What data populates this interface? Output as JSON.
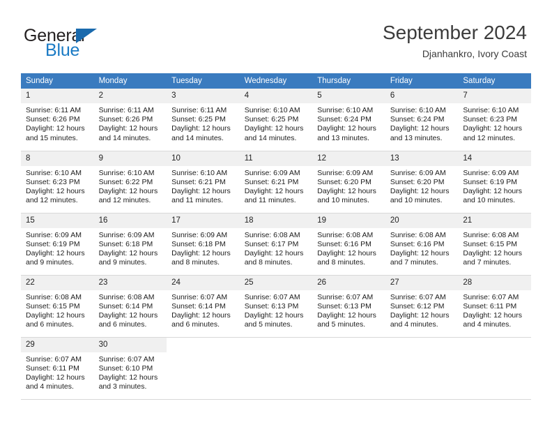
{
  "brand": {
    "name_top": "General",
    "name_bottom": "Blue",
    "triangle_icon": "triangle-icon",
    "color_dark": "#231f20",
    "color_blue": "#1a7ac4"
  },
  "header": {
    "month_title": "September 2024",
    "location": "Djanhankro, Ivory Coast"
  },
  "calendar": {
    "accent_color": "#3a7bbf",
    "daynum_bg": "#f0f0f0",
    "weekdays": [
      "Sunday",
      "Monday",
      "Tuesday",
      "Wednesday",
      "Thursday",
      "Friday",
      "Saturday"
    ],
    "weeks": [
      [
        {
          "day": "1",
          "sunrise": "Sunrise: 6:11 AM",
          "sunset": "Sunset: 6:26 PM",
          "daylight1": "Daylight: 12 hours",
          "daylight2": "and 15 minutes."
        },
        {
          "day": "2",
          "sunrise": "Sunrise: 6:11 AM",
          "sunset": "Sunset: 6:26 PM",
          "daylight1": "Daylight: 12 hours",
          "daylight2": "and 14 minutes."
        },
        {
          "day": "3",
          "sunrise": "Sunrise: 6:11 AM",
          "sunset": "Sunset: 6:25 PM",
          "daylight1": "Daylight: 12 hours",
          "daylight2": "and 14 minutes."
        },
        {
          "day": "4",
          "sunrise": "Sunrise: 6:10 AM",
          "sunset": "Sunset: 6:25 PM",
          "daylight1": "Daylight: 12 hours",
          "daylight2": "and 14 minutes."
        },
        {
          "day": "5",
          "sunrise": "Sunrise: 6:10 AM",
          "sunset": "Sunset: 6:24 PM",
          "daylight1": "Daylight: 12 hours",
          "daylight2": "and 13 minutes."
        },
        {
          "day": "6",
          "sunrise": "Sunrise: 6:10 AM",
          "sunset": "Sunset: 6:24 PM",
          "daylight1": "Daylight: 12 hours",
          "daylight2": "and 13 minutes."
        },
        {
          "day": "7",
          "sunrise": "Sunrise: 6:10 AM",
          "sunset": "Sunset: 6:23 PM",
          "daylight1": "Daylight: 12 hours",
          "daylight2": "and 12 minutes."
        }
      ],
      [
        {
          "day": "8",
          "sunrise": "Sunrise: 6:10 AM",
          "sunset": "Sunset: 6:23 PM",
          "daylight1": "Daylight: 12 hours",
          "daylight2": "and 12 minutes."
        },
        {
          "day": "9",
          "sunrise": "Sunrise: 6:10 AM",
          "sunset": "Sunset: 6:22 PM",
          "daylight1": "Daylight: 12 hours",
          "daylight2": "and 12 minutes."
        },
        {
          "day": "10",
          "sunrise": "Sunrise: 6:10 AM",
          "sunset": "Sunset: 6:21 PM",
          "daylight1": "Daylight: 12 hours",
          "daylight2": "and 11 minutes."
        },
        {
          "day": "11",
          "sunrise": "Sunrise: 6:09 AM",
          "sunset": "Sunset: 6:21 PM",
          "daylight1": "Daylight: 12 hours",
          "daylight2": "and 11 minutes."
        },
        {
          "day": "12",
          "sunrise": "Sunrise: 6:09 AM",
          "sunset": "Sunset: 6:20 PM",
          "daylight1": "Daylight: 12 hours",
          "daylight2": "and 10 minutes."
        },
        {
          "day": "13",
          "sunrise": "Sunrise: 6:09 AM",
          "sunset": "Sunset: 6:20 PM",
          "daylight1": "Daylight: 12 hours",
          "daylight2": "and 10 minutes."
        },
        {
          "day": "14",
          "sunrise": "Sunrise: 6:09 AM",
          "sunset": "Sunset: 6:19 PM",
          "daylight1": "Daylight: 12 hours",
          "daylight2": "and 10 minutes."
        }
      ],
      [
        {
          "day": "15",
          "sunrise": "Sunrise: 6:09 AM",
          "sunset": "Sunset: 6:19 PM",
          "daylight1": "Daylight: 12 hours",
          "daylight2": "and 9 minutes."
        },
        {
          "day": "16",
          "sunrise": "Sunrise: 6:09 AM",
          "sunset": "Sunset: 6:18 PM",
          "daylight1": "Daylight: 12 hours",
          "daylight2": "and 9 minutes."
        },
        {
          "day": "17",
          "sunrise": "Sunrise: 6:09 AM",
          "sunset": "Sunset: 6:18 PM",
          "daylight1": "Daylight: 12 hours",
          "daylight2": "and 8 minutes."
        },
        {
          "day": "18",
          "sunrise": "Sunrise: 6:08 AM",
          "sunset": "Sunset: 6:17 PM",
          "daylight1": "Daylight: 12 hours",
          "daylight2": "and 8 minutes."
        },
        {
          "day": "19",
          "sunrise": "Sunrise: 6:08 AM",
          "sunset": "Sunset: 6:16 PM",
          "daylight1": "Daylight: 12 hours",
          "daylight2": "and 8 minutes."
        },
        {
          "day": "20",
          "sunrise": "Sunrise: 6:08 AM",
          "sunset": "Sunset: 6:16 PM",
          "daylight1": "Daylight: 12 hours",
          "daylight2": "and 7 minutes."
        },
        {
          "day": "21",
          "sunrise": "Sunrise: 6:08 AM",
          "sunset": "Sunset: 6:15 PM",
          "daylight1": "Daylight: 12 hours",
          "daylight2": "and 7 minutes."
        }
      ],
      [
        {
          "day": "22",
          "sunrise": "Sunrise: 6:08 AM",
          "sunset": "Sunset: 6:15 PM",
          "daylight1": "Daylight: 12 hours",
          "daylight2": "and 6 minutes."
        },
        {
          "day": "23",
          "sunrise": "Sunrise: 6:08 AM",
          "sunset": "Sunset: 6:14 PM",
          "daylight1": "Daylight: 12 hours",
          "daylight2": "and 6 minutes."
        },
        {
          "day": "24",
          "sunrise": "Sunrise: 6:07 AM",
          "sunset": "Sunset: 6:14 PM",
          "daylight1": "Daylight: 12 hours",
          "daylight2": "and 6 minutes."
        },
        {
          "day": "25",
          "sunrise": "Sunrise: 6:07 AM",
          "sunset": "Sunset: 6:13 PM",
          "daylight1": "Daylight: 12 hours",
          "daylight2": "and 5 minutes."
        },
        {
          "day": "26",
          "sunrise": "Sunrise: 6:07 AM",
          "sunset": "Sunset: 6:13 PM",
          "daylight1": "Daylight: 12 hours",
          "daylight2": "and 5 minutes."
        },
        {
          "day": "27",
          "sunrise": "Sunrise: 6:07 AM",
          "sunset": "Sunset: 6:12 PM",
          "daylight1": "Daylight: 12 hours",
          "daylight2": "and 4 minutes."
        },
        {
          "day": "28",
          "sunrise": "Sunrise: 6:07 AM",
          "sunset": "Sunset: 6:11 PM",
          "daylight1": "Daylight: 12 hours",
          "daylight2": "and 4 minutes."
        }
      ],
      [
        {
          "day": "29",
          "sunrise": "Sunrise: 6:07 AM",
          "sunset": "Sunset: 6:11 PM",
          "daylight1": "Daylight: 12 hours",
          "daylight2": "and 4 minutes."
        },
        {
          "day": "30",
          "sunrise": "Sunrise: 6:07 AM",
          "sunset": "Sunset: 6:10 PM",
          "daylight1": "Daylight: 12 hours",
          "daylight2": "and 3 minutes."
        },
        {
          "day": "",
          "sunrise": "",
          "sunset": "",
          "daylight1": "",
          "daylight2": ""
        },
        {
          "day": "",
          "sunrise": "",
          "sunset": "",
          "daylight1": "",
          "daylight2": ""
        },
        {
          "day": "",
          "sunrise": "",
          "sunset": "",
          "daylight1": "",
          "daylight2": ""
        },
        {
          "day": "",
          "sunrise": "",
          "sunset": "",
          "daylight1": "",
          "daylight2": ""
        },
        {
          "day": "",
          "sunrise": "",
          "sunset": "",
          "daylight1": "",
          "daylight2": ""
        }
      ]
    ]
  }
}
